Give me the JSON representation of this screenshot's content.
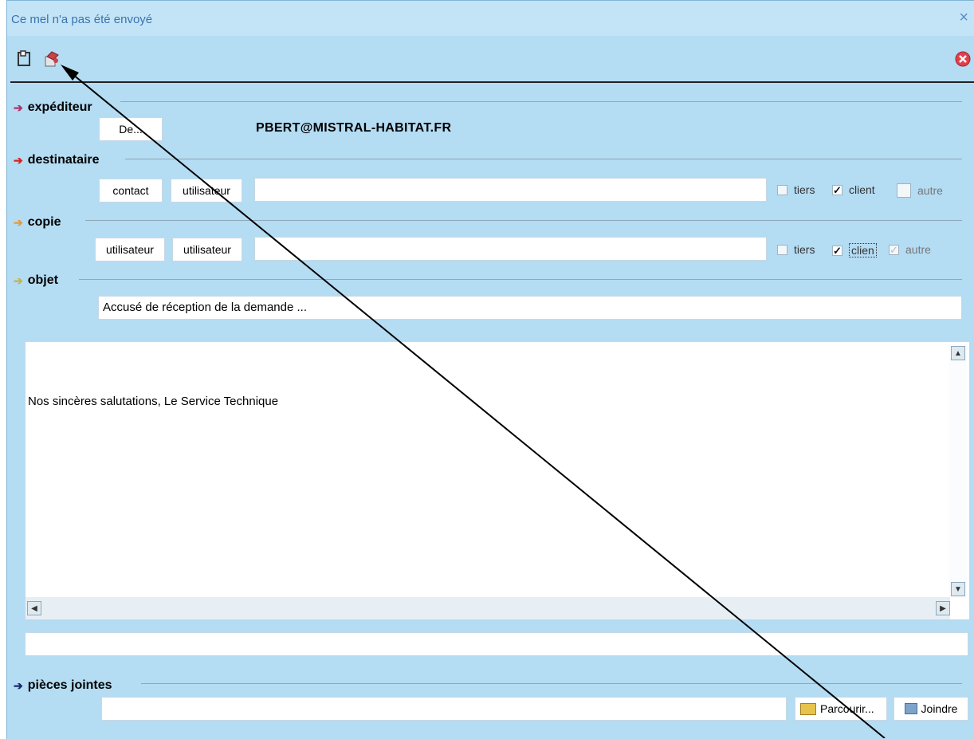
{
  "window": {
    "title": "Ce mel n'a pas été envoyé",
    "close_glyph": "×"
  },
  "toolbar": {
    "left_icons": [
      "save-icon",
      "send-icon"
    ],
    "right_icon": "cancel-icon"
  },
  "sender": {
    "section_label": "expéditeur",
    "from_button": "De...",
    "address": "PBERT@MISTRAL-HABITAT.FR"
  },
  "recipient": {
    "section_label": "destinataire",
    "button1": "contact",
    "button2": "utilisateur",
    "field_value": "",
    "checks": {
      "tiers": "tiers",
      "client": "client",
      "autre": "autre"
    },
    "checked": {
      "tiers": false,
      "client": true,
      "autre": false
    }
  },
  "copy": {
    "section_label": "copie",
    "button1": "utilisateur",
    "button2": "utilisateur",
    "field_value": "",
    "checks": {
      "tiers": "tiers",
      "client": "clien",
      "autre": "autre"
    },
    "checked": {
      "tiers": false,
      "client": true,
      "autre": true
    }
  },
  "subject": {
    "section_label": "objet",
    "value": "Accusé de réception de la demande ..."
  },
  "message": {
    "body": "Nos sincères salutations, Le Service Technique"
  },
  "attachments": {
    "section_label": "pièces jointes",
    "field_value": "",
    "browse_button": "Parcourir...",
    "attach_button": "Joindre"
  },
  "colors": {
    "window_bg": "#b4dcf3",
    "title_text": "#3a73b0",
    "arrow_sender": "#b0306a",
    "arrow_recipient": "#d8231f",
    "arrow_copy": "#e59a3a",
    "arrow_subject": "#c8b348",
    "arrow_attachments": "#1a2a6e"
  }
}
